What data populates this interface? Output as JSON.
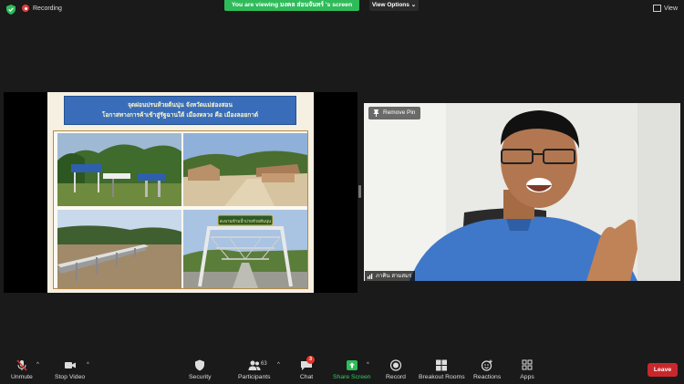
{
  "topbar": {
    "recording_label": "Recording",
    "banner_text": "You are viewing มงคล ส่อนจันทร์ 's screen",
    "view_options_label": "View Options",
    "view_label": "View"
  },
  "shared_screen": {
    "slide_title_line1": "จุดผ่อนปรนห้วยต้นนุ่น จังหวัดแม่ฮ่องสอน",
    "slide_title_line2": "โอกาสทางการค้าเข้าสู่รัฐฉานใต้ เมืองหลวง คือ เมืองลอยกาต์",
    "bridge_sign_text": "สะพานข้ามน้ำปายห้วยต้นนุ่น"
  },
  "participant": {
    "remove_pin_label": "Remove Pin",
    "name": "ภาคิน สามสมร"
  },
  "toolbar": {
    "unmute_label": "Unmute",
    "stop_video_label": "Stop Video",
    "security_label": "Security",
    "participants_label": "Participants",
    "participants_count": "63",
    "chat_label": "Chat",
    "chat_badge": "3",
    "share_screen_label": "Share Screen",
    "record_label": "Record",
    "breakout_label": "Breakout Rooms",
    "reactions_label": "Reactions",
    "apps_label": "Apps",
    "leave_label": "Leave"
  },
  "colors": {
    "share_green": "#2fbb5a",
    "leave_red": "#c8282c",
    "recording_red": "#d9413c"
  }
}
